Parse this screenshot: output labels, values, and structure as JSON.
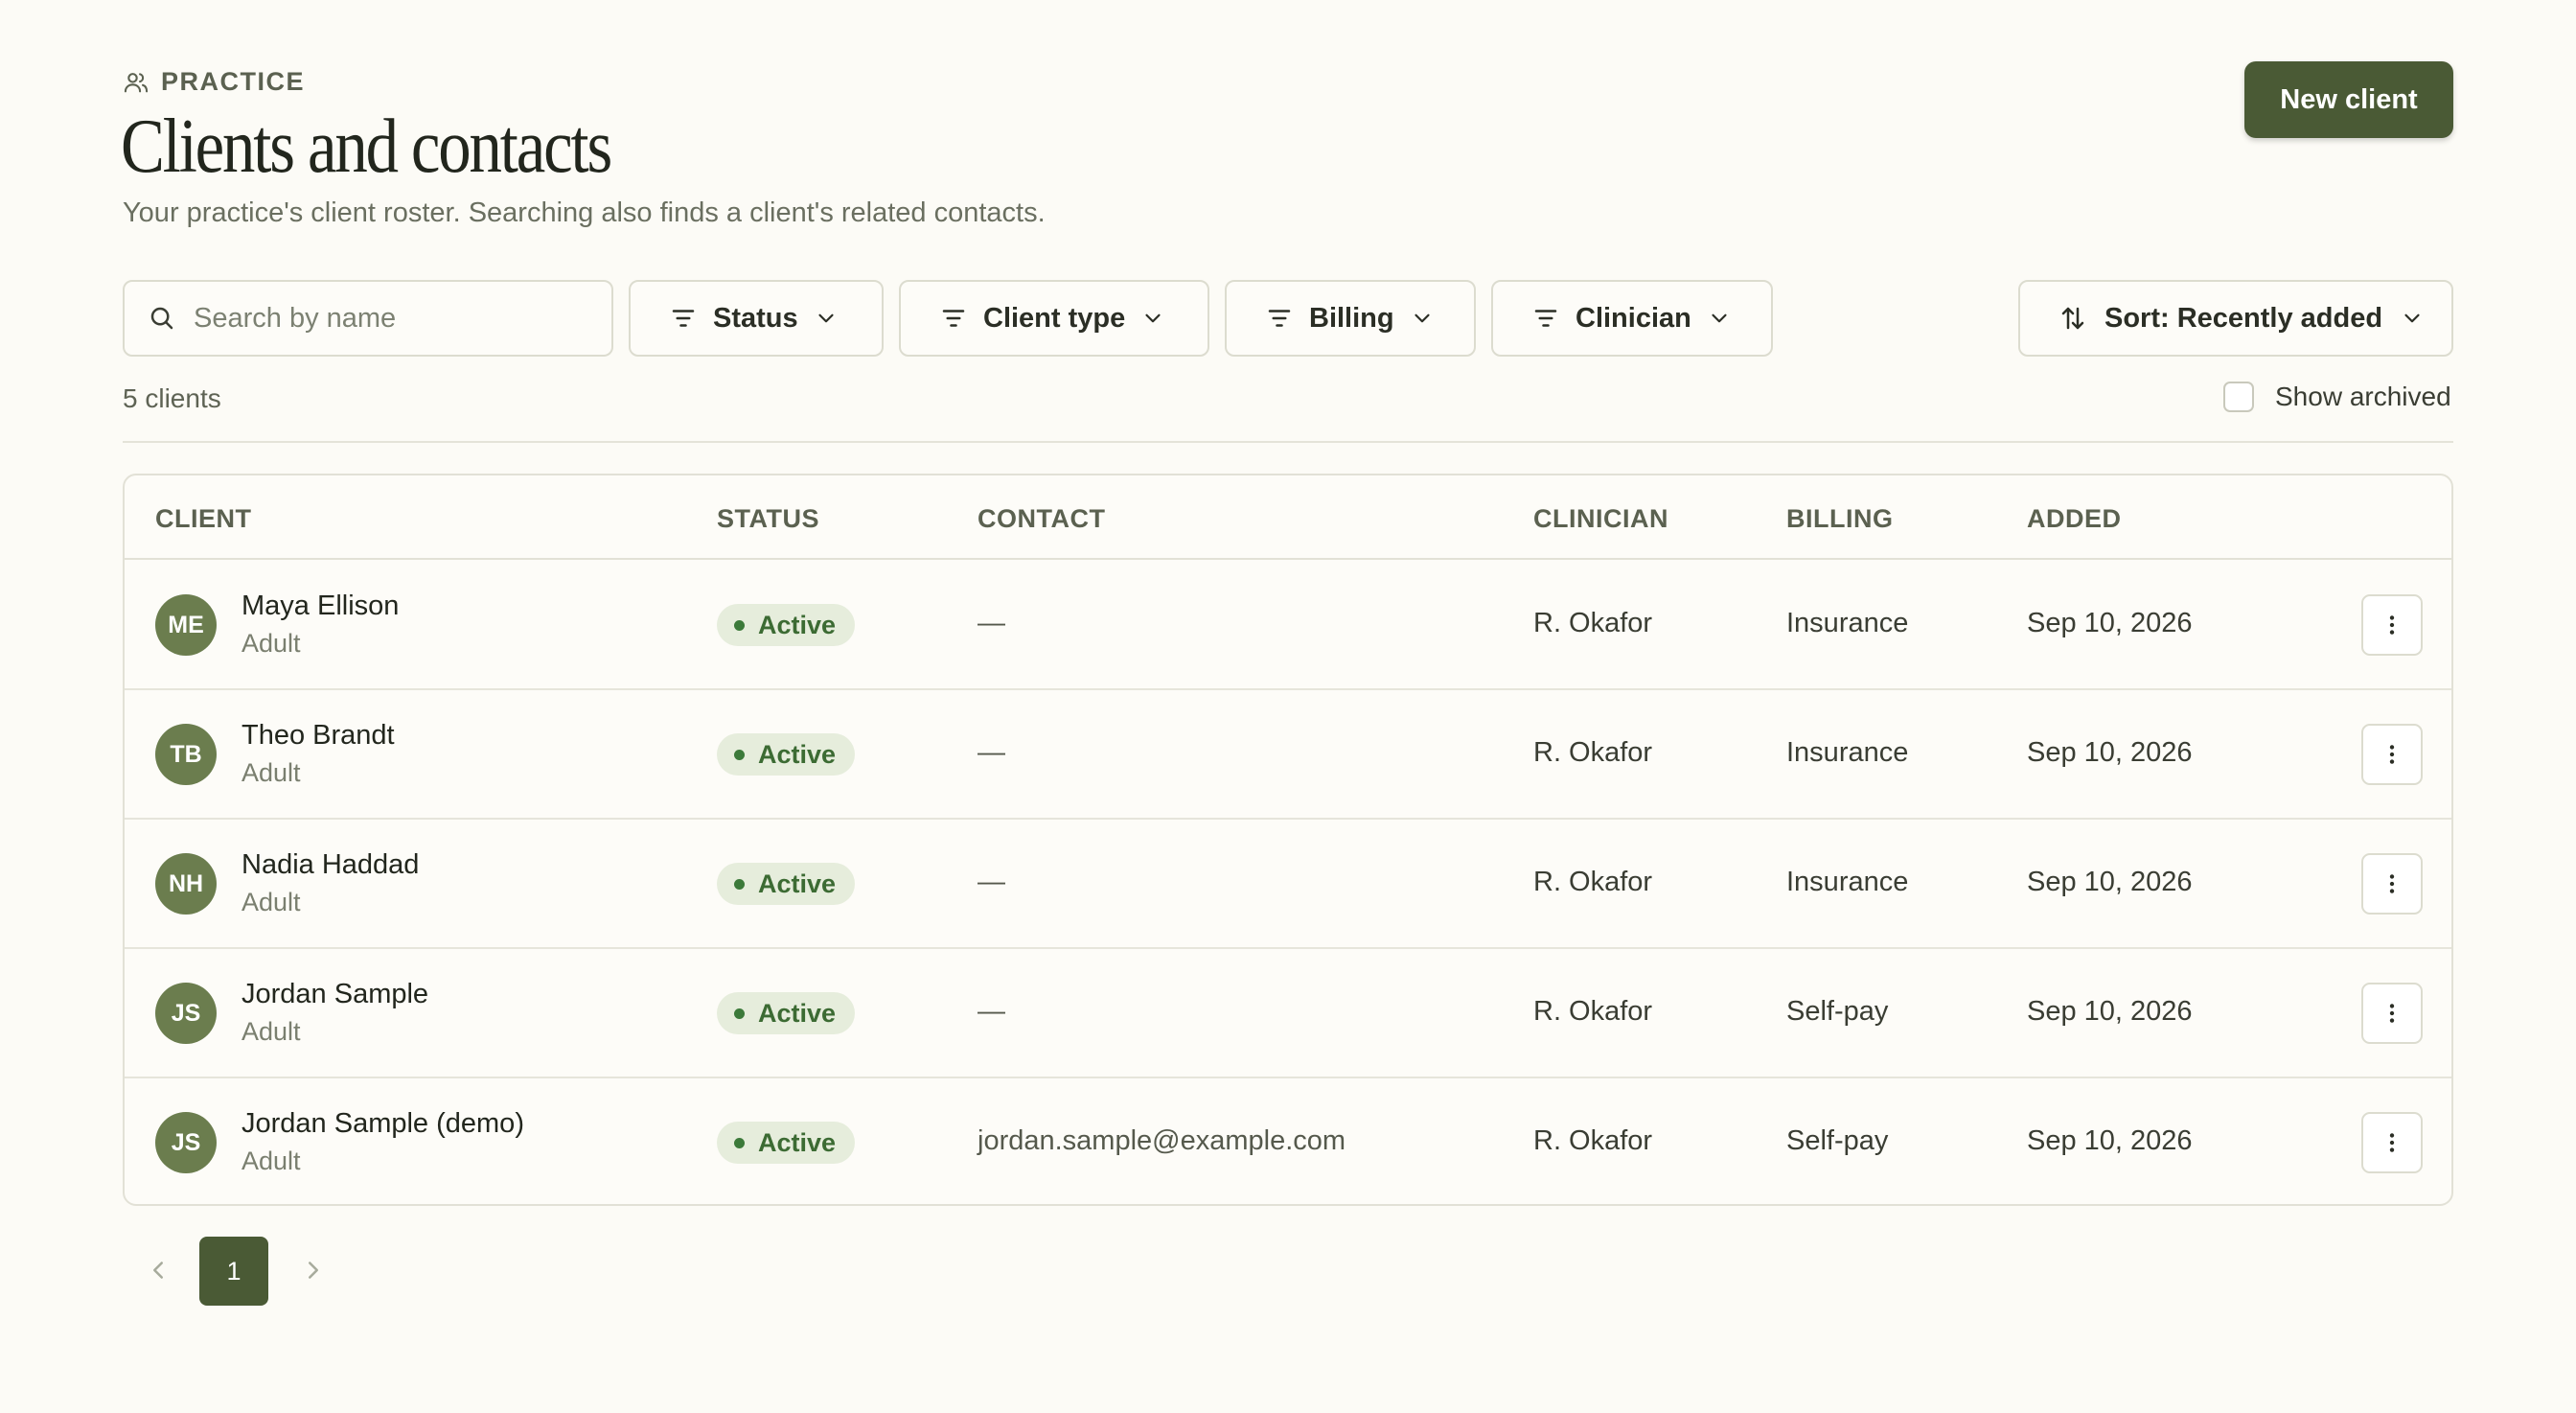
{
  "header": {
    "eyebrow": "PRACTICE",
    "title": "Clients and contacts",
    "subtitle": "Your practice's client roster. Searching also finds a client's related contacts.",
    "new_client_label": "New client"
  },
  "filters": {
    "search_placeholder": "Search by name",
    "status_label": "Status",
    "client_type_label": "Client type",
    "billing_label": "Billing",
    "clinician_label": "Clinician",
    "sort_label": "Sort: Recently added"
  },
  "summary": {
    "count": "5 clients",
    "show_archived_label": "Show archived"
  },
  "table": {
    "columns": [
      "CLIENT",
      "STATUS",
      "CONTACT",
      "CLINICIAN",
      "BILLING",
      "ADDED"
    ],
    "rows": [
      {
        "initials": "ME",
        "name": "Maya Ellison",
        "type": "Adult",
        "status": "Active",
        "contact": "—",
        "clinician": "R. Okafor",
        "billing": "Insurance",
        "added": "Sep 10, 2026"
      },
      {
        "initials": "TB",
        "name": "Theo Brandt",
        "type": "Adult",
        "status": "Active",
        "contact": "—",
        "clinician": "R. Okafor",
        "billing": "Insurance",
        "added": "Sep 10, 2026"
      },
      {
        "initials": "NH",
        "name": "Nadia Haddad",
        "type": "Adult",
        "status": "Active",
        "contact": "—",
        "clinician": "R. Okafor",
        "billing": "Insurance",
        "added": "Sep 10, 2026"
      },
      {
        "initials": "JS",
        "name": "Jordan Sample",
        "type": "Adult",
        "status": "Active",
        "contact": "—",
        "clinician": "R. Okafor",
        "billing": "Self-pay",
        "added": "Sep 10, 2026"
      },
      {
        "initials": "JS",
        "name": "Jordan Sample (demo)",
        "type": "Adult",
        "status": "Active",
        "contact": "jordan.sample@example.com",
        "clinician": "R. Okafor",
        "billing": "Self-pay",
        "added": "Sep 10, 2026"
      }
    ]
  },
  "pagination": {
    "current_page": "1"
  },
  "colors": {
    "accent": "#4a5a35",
    "avatar": "#6b7d4e",
    "status_active_bg": "#e6eddc",
    "status_active_text": "#3c6b33",
    "page_bg": "#fcfbf6"
  },
  "icons": {
    "eyebrow": "users-icon",
    "search": "search-icon",
    "filter": "filter-icon",
    "dropdown": "chevron-down-icon",
    "sort": "sort-arrows-icon",
    "row_menu": "more-vertical-icon",
    "prev": "chevron-left-icon",
    "next": "chevron-right-icon"
  }
}
